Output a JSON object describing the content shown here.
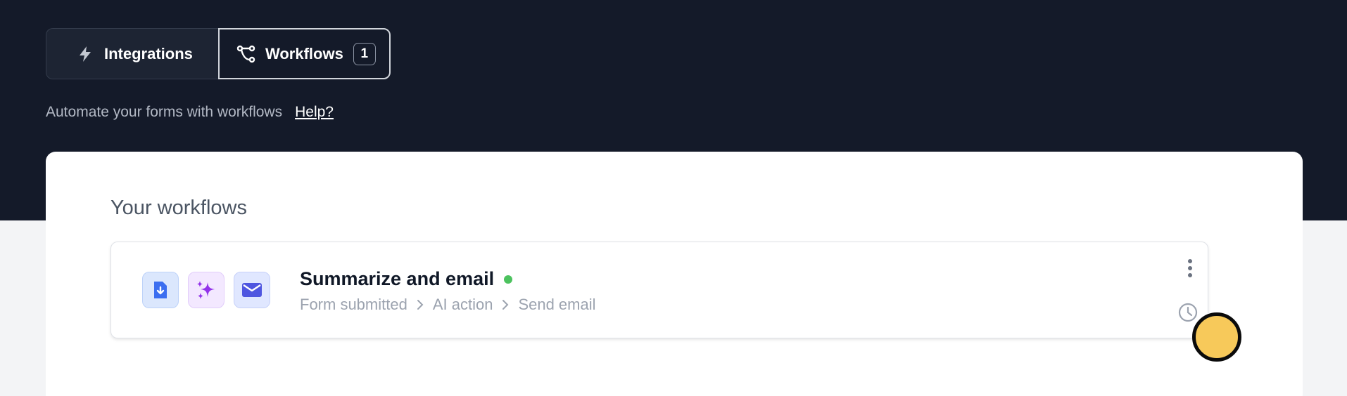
{
  "tabs": {
    "integrations": {
      "label": "Integrations",
      "icon": "bolt-icon"
    },
    "workflows": {
      "label": "Workflows",
      "icon": "branch-icon",
      "count": "1"
    }
  },
  "intro": {
    "text": "Automate your forms with workflows",
    "help_label": "Help?"
  },
  "panel": {
    "title": "Your workflows",
    "workflows": [
      {
        "name": "Summarize and email",
        "status": "active",
        "status_color": "#4cc25e",
        "step_icons": [
          "file-download-icon",
          "sparkles-icon",
          "envelope-icon"
        ],
        "steps": [
          "Form submitted",
          "AI action",
          "Send email"
        ]
      }
    ]
  },
  "colors": {
    "header_bg": "#141a29",
    "page_bg": "#f3f4f6",
    "accent_blue": "#3b6ef0",
    "accent_purple": "#9333ea",
    "accent_indigo": "#4f56e0"
  }
}
